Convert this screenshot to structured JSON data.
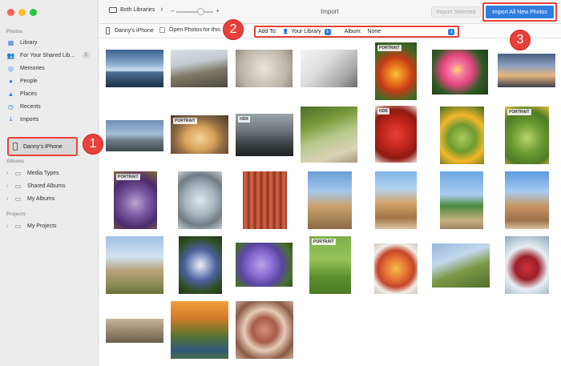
{
  "sidebar": {
    "sections": {
      "photos": "Photos",
      "albums": "Albums",
      "projects": "Projects"
    },
    "items": [
      {
        "label": "Library",
        "icon": "library-icon"
      },
      {
        "label": "For Your Shared Lib...",
        "icon": "shared-library-icon",
        "badge": "5"
      },
      {
        "label": "Memories",
        "icon": "memories-icon"
      },
      {
        "label": "People",
        "icon": "people-icon"
      },
      {
        "label": "Places",
        "icon": "places-icon"
      },
      {
        "label": "Recents",
        "icon": "recents-icon"
      },
      {
        "label": "Imports",
        "icon": "imports-icon"
      }
    ],
    "device": "Danny's iPhone",
    "album_items": [
      {
        "label": "Media Types"
      },
      {
        "label": "Shared Albums"
      },
      {
        "label": "My Albums"
      }
    ],
    "project_items": [
      {
        "label": "My Projects"
      }
    ]
  },
  "toolbar": {
    "library_select": "Both Libraries",
    "title": "Import",
    "import_selected": "Import Selected",
    "import_all": "Import All New Photos"
  },
  "subbar": {
    "device": "Danny's iPhone",
    "open_photos": "Open Photos for this",
    "add_to_label": "Add To:",
    "add_to_value": "Your Library",
    "album_label": "Album:",
    "album_value": "None"
  },
  "callouts": [
    "1",
    "2",
    "3"
  ],
  "photos": [
    {
      "tag": ""
    },
    {
      "tag": ""
    },
    {
      "tag": ""
    },
    {
      "tag": ""
    },
    {
      "tag": "PORTRAIT"
    },
    {
      "tag": ""
    },
    {
      "tag": ""
    },
    {
      "tag": ""
    },
    {
      "tag": "PORTRAIT"
    },
    {
      "tag": "HDR"
    },
    {
      "tag": ""
    },
    {
      "tag": "HDR"
    },
    {
      "tag": ""
    },
    {
      "tag": "PORTRAIT"
    },
    {
      "tag": "PORTRAIT"
    },
    {
      "tag": ""
    },
    {
      "tag": ""
    },
    {
      "tag": ""
    },
    {
      "tag": ""
    },
    {
      "tag": ""
    },
    {
      "tag": ""
    },
    {
      "tag": ""
    },
    {
      "tag": ""
    },
    {
      "tag": ""
    },
    {
      "tag": "PORTRAIT"
    },
    {
      "tag": ""
    },
    {
      "tag": ""
    },
    {
      "tag": ""
    },
    {
      "tag": ""
    },
    {
      "tag": ""
    },
    {
      "tag": ""
    }
  ],
  "colors": {
    "accent": "#2f7de1",
    "callout": "#e8413a"
  }
}
